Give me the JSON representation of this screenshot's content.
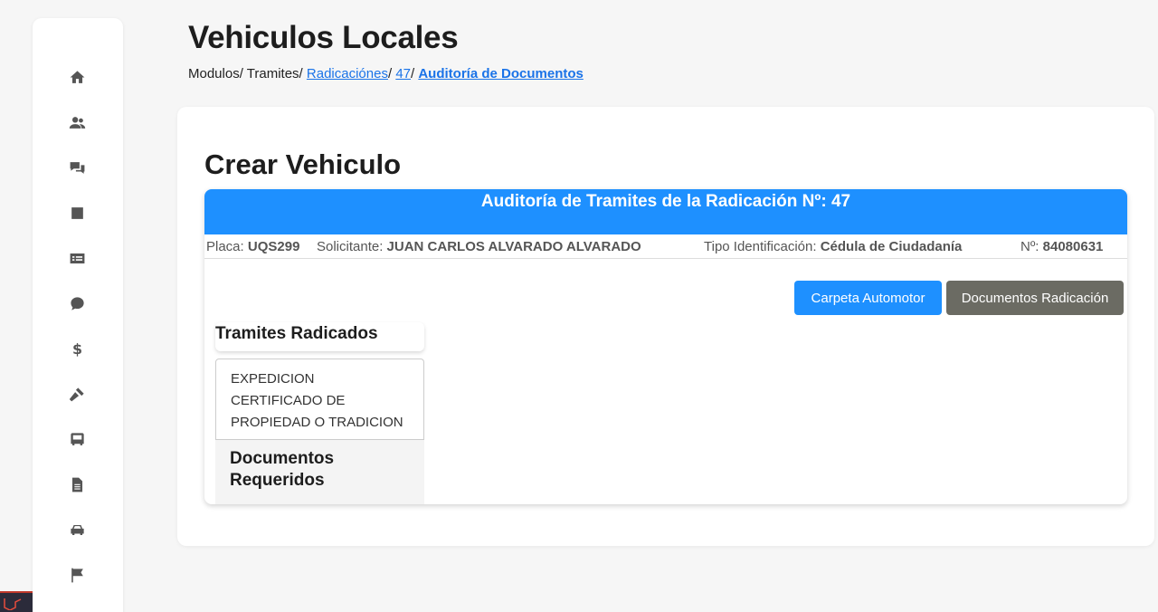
{
  "app": {
    "title": "Vehiculos Locales"
  },
  "breadcrumb": {
    "modulos": "Modulos/",
    "tramites": "Tramites/",
    "radicaciones": "Radicaciónes",
    "sep1": "/",
    "id": "47",
    "sep2": "/",
    "current": "Auditoría de Documentos"
  },
  "sidebar": {
    "icons": [
      "home-icon",
      "users-icon",
      "comments-question-icon",
      "inbox-icon",
      "money-card-icon",
      "dollar-chat-icon",
      "dollar-icon",
      "gavel-icon",
      "bus-icon",
      "document-icon",
      "car-icon",
      "flag-icon"
    ]
  },
  "card": {
    "title": "Crear Vehiculo",
    "panel_header": "Auditoría de Tramites de la Radicación Nº: 47"
  },
  "info": {
    "placa_label": "Placa:",
    "placa_value": "UQS299",
    "solicitante_label": "Solicitante:",
    "solicitante_value": "JUAN CARLOS ALVARADO ALVARADO",
    "tipo_label": "Tipo Identificación:",
    "tipo_value": "Cédula de Ciudadanía",
    "numero_label": "Nº:",
    "numero_value": "84080631"
  },
  "buttons": {
    "carpeta": "Carpeta Automotor",
    "documentos": "Documentos Radicación"
  },
  "tramites": {
    "label": "Tramites Radicados",
    "items": [
      "EXPEDICION CERTIFICADO DE PROPIEDAD O TRADICION"
    ]
  },
  "documentos_requeridos": {
    "label": "Documentos Requeridos"
  },
  "colors": {
    "primary": "#1e90ff",
    "secondary": "#6b6b63",
    "link": "#1a73e8"
  }
}
